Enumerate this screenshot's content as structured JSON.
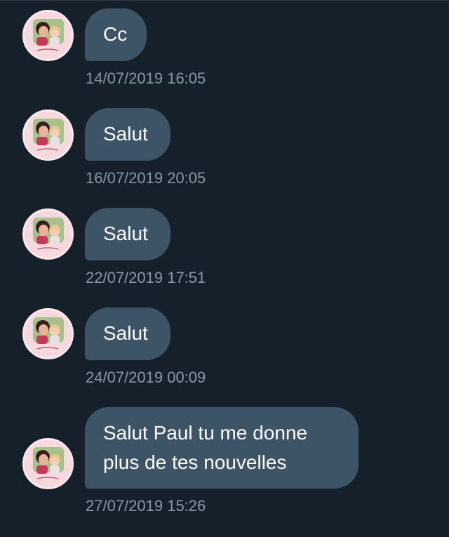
{
  "conversation": {
    "messages": [
      {
        "text": "Cc",
        "timestamp": "14/07/2019 16:05"
      },
      {
        "text": "Salut",
        "timestamp": "16/07/2019 20:05"
      },
      {
        "text": "Salut",
        "timestamp": "22/07/2019 17:51"
      },
      {
        "text": "Salut",
        "timestamp": "24/07/2019 00:09"
      },
      {
        "text": "Salut Paul tu me donne\nplus de tes nouvelles",
        "timestamp": "27/07/2019 15:26"
      }
    ]
  },
  "colors": {
    "background": "#15202b",
    "bubble": "#3d5466",
    "message_text": "#ffffff",
    "timestamp_text": "#8899a6",
    "avatar_frame": "#f6d9de"
  },
  "icons": {
    "avatar": "user-avatar-photo"
  }
}
